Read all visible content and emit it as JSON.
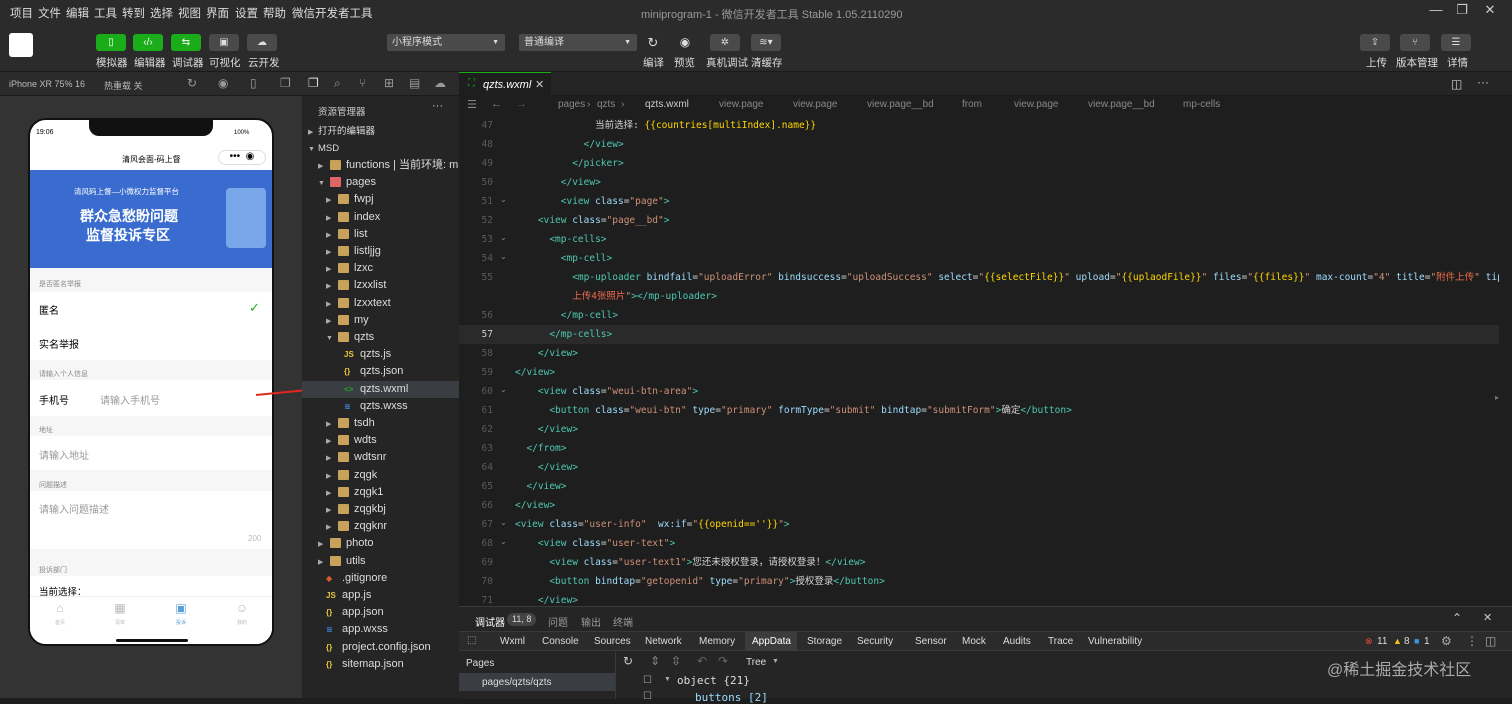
{
  "menu": [
    "项目",
    "文件",
    "编辑",
    "工具",
    "转到",
    "选择",
    "视图",
    "界面",
    "设置",
    "帮助",
    "微信开发者工具"
  ],
  "window_title": "miniprogram-1 - 微信开发者工具 Stable 1.05.2110290",
  "toolbar": {
    "buttons": [
      {
        "icon": "phone-icon",
        "label": "模拟器"
      },
      {
        "icon": "code-icon",
        "label": "编辑器"
      },
      {
        "icon": "debug-icon",
        "label": "调试器"
      },
      {
        "icon": "visual-icon",
        "label": "可视化"
      },
      {
        "icon": "cloud-icon",
        "label": "云开发"
      }
    ],
    "mode_select": "小程序模式",
    "compile_select": "普通编译",
    "actions": [
      "编译",
      "预览",
      "真机调试",
      "清缓存"
    ],
    "right": [
      "上传",
      "版本管理",
      "详情"
    ]
  },
  "simulator": {
    "device": "iPhone XR 75% 16",
    "hotreload": "热重载 关",
    "time": "19:06",
    "battery": "100%",
    "nav_title": "清风会面-码上督",
    "banner_small": "清风码上督—小微权力监督平台",
    "banner_line1": "群众急愁盼问题",
    "banner_line2": "监督投诉专区",
    "section1": "是否匿名举报",
    "opt1": "匿名",
    "opt2": "实名举报",
    "section2": "请输入个人信息",
    "phone_label": "手机号",
    "phone_ph": "请输入手机号",
    "section3": "地址",
    "addr_ph": "请输入地址",
    "section4": "问题描述",
    "desc_ph": "请输入问题描述",
    "counter": "200",
    "section5": "投诉部门",
    "current": "当前选择：",
    "tabbar": [
      "首页",
      "清单",
      "投诉",
      "我的"
    ]
  },
  "explorer": {
    "title": "资源管理器",
    "open_editors": "打开的编辑器",
    "root": "MSD",
    "tree": [
      {
        "name": "functions | 当前环境: m...",
        "type": "folder",
        "depth": 1,
        "open": false
      },
      {
        "name": "pages",
        "type": "folder",
        "depth": 1,
        "open": true
      },
      {
        "name": "fwpj",
        "type": "folder",
        "depth": 2,
        "open": false
      },
      {
        "name": "index",
        "type": "folder",
        "depth": 2,
        "open": false
      },
      {
        "name": "list",
        "type": "folder",
        "depth": 2,
        "open": false
      },
      {
        "name": "listljjg",
        "type": "folder",
        "depth": 2,
        "open": false
      },
      {
        "name": "lzxc",
        "type": "folder",
        "depth": 2,
        "open": false
      },
      {
        "name": "lzxxlist",
        "type": "folder",
        "depth": 2,
        "open": false
      },
      {
        "name": "lzxxtext",
        "type": "folder",
        "depth": 2,
        "open": false
      },
      {
        "name": "my",
        "type": "folder",
        "depth": 2,
        "open": false
      },
      {
        "name": "qzts",
        "type": "folder",
        "depth": 2,
        "open": true
      },
      {
        "name": "qzts.js",
        "type": "js",
        "depth": 3
      },
      {
        "name": "qzts.json",
        "type": "json",
        "depth": 3
      },
      {
        "name": "qzts.wxml",
        "type": "wxml",
        "depth": 3,
        "selected": true
      },
      {
        "name": "qzts.wxss",
        "type": "wxss",
        "depth": 3
      },
      {
        "name": "tsdh",
        "type": "folder",
        "depth": 2,
        "open": false
      },
      {
        "name": "wdts",
        "type": "folder",
        "depth": 2,
        "open": false
      },
      {
        "name": "wdtsnr",
        "type": "folder",
        "depth": 2,
        "open": false
      },
      {
        "name": "zqgk",
        "type": "folder",
        "depth": 2,
        "open": false
      },
      {
        "name": "zqgk1",
        "type": "folder",
        "depth": 2,
        "open": false
      },
      {
        "name": "zqgkbj",
        "type": "folder",
        "depth": 2,
        "open": false
      },
      {
        "name": "zqgknr",
        "type": "folder",
        "depth": 2,
        "open": false
      },
      {
        "name": "photo",
        "type": "folder",
        "depth": 1,
        "open": false
      },
      {
        "name": "utils",
        "type": "folder",
        "depth": 1,
        "open": false
      },
      {
        "name": ".gitignore",
        "type": "git",
        "depth": 1
      },
      {
        "name": "app.js",
        "type": "js",
        "depth": 1
      },
      {
        "name": "app.json",
        "type": "json",
        "depth": 1
      },
      {
        "name": "app.wxss",
        "type": "wxss",
        "depth": 1
      },
      {
        "name": "project.config.json",
        "type": "json",
        "depth": 1
      },
      {
        "name": "sitemap.json",
        "type": "json",
        "depth": 1
      }
    ]
  },
  "editor": {
    "tab": "qzts.wxml",
    "breadcrumb": [
      "pages",
      "qzts",
      "qzts.wxml",
      "view.page",
      "view.page",
      "view.page__bd",
      "from",
      "view.page",
      "view.page__bd",
      "mp-cells"
    ]
  },
  "devtools": {
    "tab_active": "调试器",
    "pos": "11, 8",
    "tabs2": [
      "问题",
      "输出",
      "终端"
    ],
    "panels": [
      "Wxml",
      "Console",
      "Sources",
      "Network",
      "Memory",
      "AppData",
      "Storage",
      "Security",
      "Sensor",
      "Mock",
      "Audits",
      "Trace",
      "Vulnerability"
    ],
    "active_panel": "AppData",
    "errors": "11",
    "warnings": "8",
    "infos": "1",
    "pages_label": "Pages",
    "page_item": "pages/qzts/qzts",
    "tree_mode": "Tree",
    "object": "object {21}",
    "buttons_row": "buttons [2]"
  },
  "watermark": "@稀土掘金技术社区"
}
